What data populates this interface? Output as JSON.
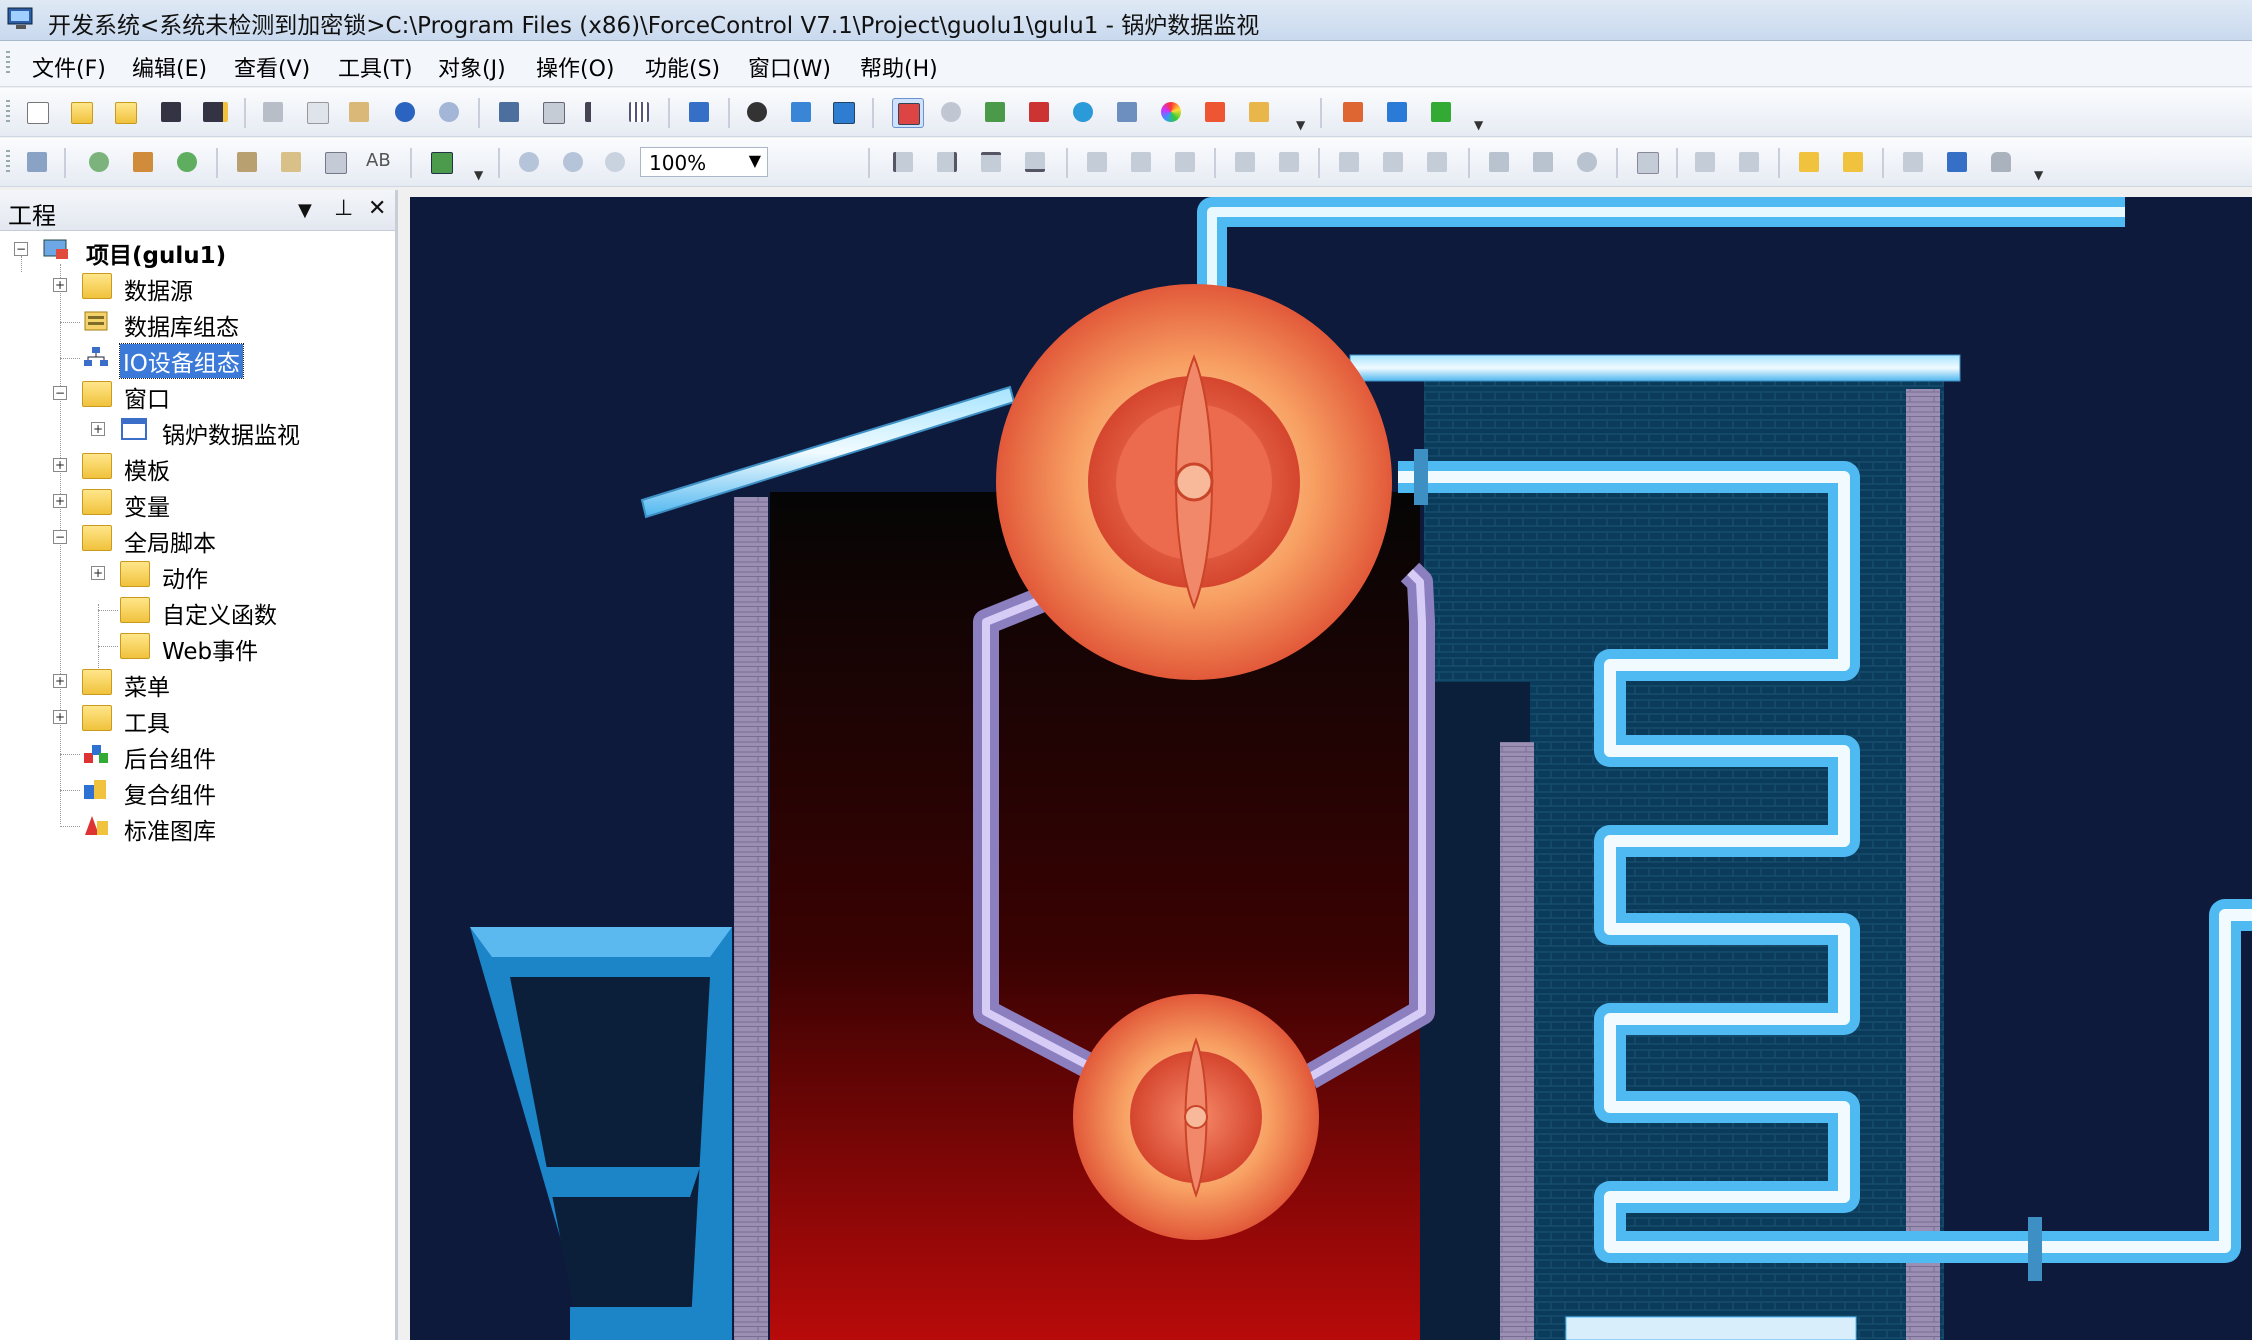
{
  "window": {
    "title": "开发系统<系统未检测到加密锁>C:\\Program Files (x86)\\ForceControl V7.1\\Project\\guolu1\\gulu1 - 锅炉数据监视"
  },
  "menu": [
    "文件(F)",
    "编辑(E)",
    "查看(V)",
    "工具(T)",
    "对象(J)",
    "操作(O)",
    "功能(S)",
    "窗口(W)",
    "帮助(H)"
  ],
  "toolbar": {
    "zoom_value": "100%",
    "text_button": "AB"
  },
  "panel": {
    "title": "工程",
    "dropdown_glyph": "▼",
    "pin_glyph": "⊥",
    "close_glyph": "✕"
  },
  "tree": {
    "root": "项目(gulu1)",
    "datasource": "数据源",
    "db_config": "数据库组态",
    "io_config": "IO设备组态",
    "windows": "窗口",
    "window_item": "锅炉数据监视",
    "templates": "模板",
    "variables": "变量",
    "global_script": "全局脚本",
    "actions": "动作",
    "custom_funcs": "自定义函数",
    "web_events": "Web事件",
    "menus": "菜单",
    "tools": "工具",
    "bg_components": "后台组件",
    "composite_components": "复合组件",
    "std_library": "标准图库"
  },
  "colors": {
    "canvas_bg": "#0d1a3c",
    "pipe": "#5ac8ff",
    "drum": "#f6a06a",
    "selection": "#3b7ad9"
  }
}
